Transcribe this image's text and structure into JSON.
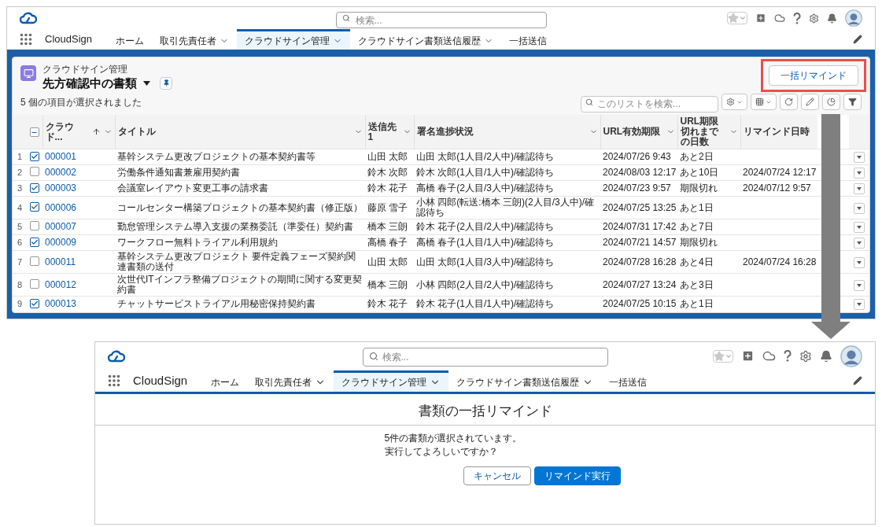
{
  "top_screen": {
    "header": {
      "search_placeholder": "検索..."
    },
    "nav": {
      "app_name": "CloudSign",
      "items": [
        {
          "label": "ホーム",
          "menu": false,
          "selected": false
        },
        {
          "label": "取引先責任者",
          "menu": true,
          "selected": false
        },
        {
          "label": "クラウドサイン管理",
          "menu": true,
          "selected": true
        },
        {
          "label": "クラウドサイン書類送信履歴",
          "menu": true,
          "selected": false
        },
        {
          "label": "一括送信",
          "menu": false,
          "selected": false
        }
      ]
    },
    "list_view": {
      "object_label": "クラウドサイン管理",
      "title": "先方確認中の書類",
      "reminder_button": "一括リマインド",
      "selection_note": "5 個の項目が選択されました",
      "search_placeholder": "このリストを検索...",
      "table": {
        "header_partial": true,
        "columns": [
          {
            "label": "クラウド...",
            "sorted": true,
            "menu": true
          },
          {
            "label": "タイトル",
            "sorted": false,
            "menu": true
          },
          {
            "label": "送信先1",
            "sorted": false,
            "menu": true
          },
          {
            "label": "署名進捗状況",
            "sorted": false,
            "menu": true
          },
          {
            "label": "URL有効期限",
            "sorted": false,
            "menu": true
          },
          {
            "label": "URL期限切れまでの日数",
            "sorted": false,
            "menu": true
          },
          {
            "label": "リマインド日時",
            "sorted": false,
            "menu": false
          }
        ],
        "rows": [
          {
            "number": "1",
            "checked": true,
            "id": "000001",
            "title": "基幹システム更改プロジェクトの基本契約書等",
            "recipient": "山田 太郎",
            "progress": "山田 太郎(1人目/2人中)/確認待ち",
            "url_expiry": "2024/07/26 9:43",
            "days_left": "あと2日"
          },
          {
            "number": "2",
            "checked": false,
            "id": "000002",
            "title": "労働条件通知書兼雇用契約書",
            "recipient": "鈴木 次郎",
            "progress": "鈴木 次郎(1人目/1人中)/確認待ち",
            "url_expiry": "2024/08/03 12:17",
            "days_left": "あと10日",
            "reminded_at": "2024/07/24 12:17"
          },
          {
            "number": "3",
            "checked": true,
            "id": "000003",
            "title": "会議室レイアウト変更工事の請求書",
            "recipient": "鈴木 花子",
            "progress": "高橋 春子(2人目/3人中)/確認待ち",
            "url_expiry": "2024/07/23 9:57",
            "days_left": "期限切れ",
            "reminded_at": "2024/07/12 9:57"
          },
          {
            "number": "4",
            "checked": true,
            "id": "000006",
            "title": "コールセンター構築プロジェクトの基本契約書（修正版）",
            "recipient": "藤原 雪子",
            "progress": "小林 四郎(転送:橋本 三朗)(2人目/3人中)/確認待ち",
            "url_expiry": "2024/07/25 13:25",
            "days_left": "あと1日"
          },
          {
            "number": "5",
            "checked": false,
            "id": "000007",
            "title": "勤怠管理システム導入支援の業務委託（準委任）契約書",
            "recipient": "橋本 三朗",
            "progress": "鈴木 花子(2人目/2人中)/確認待ち",
            "url_expiry": "2024/07/31 17:42",
            "days_left": "あと7日"
          },
          {
            "number": "6",
            "checked": true,
            "id": "000009",
            "title": "ワークフロー無料トライアル利用規約",
            "recipient": "高橋 春子",
            "progress": "高橋 春子(1人目/1人中)/確認待ち",
            "url_expiry": "2024/07/21 14:57",
            "days_left": "期限切れ"
          },
          {
            "number": "7",
            "checked": false,
            "id": "000011",
            "title": "基幹システム更改プロジェクト 要件定義フェーズ契約関連書類の送付",
            "recipient": "山田 太郎",
            "progress": "山田 太郎(1人目/3人中)/確認待ち",
            "url_expiry": "2024/07/28 16:28",
            "days_left": "あと4日",
            "reminded_at": "2024/07/24 16:28"
          },
          {
            "number": "8",
            "checked": false,
            "id": "000012",
            "title": "次世代ITインフラ整備プロジェクトの期間に関する変更契約書",
            "recipient": "橋本 三朗",
            "progress": "小林 四郎(2人目/2人中)/確認待ち",
            "url_expiry": "2024/07/27 13:24",
            "days_left": "あと3日"
          },
          {
            "number": "9",
            "checked": true,
            "id": "000013",
            "title": "チャットサービストライアル用秘密保持契約書",
            "recipient": "鈴木 花子",
            "progress": "鈴木 花子(1人目/1人中)/確認待ち",
            "url_expiry": "2024/07/25 10:15",
            "days_left": "あと1日"
          }
        ]
      }
    }
  },
  "bottom_screen": {
    "header": {
      "search_placeholder": "検索..."
    },
    "nav": {
      "app_name": "CloudSign",
      "items": [
        {
          "label": "ホーム",
          "menu": false,
          "selected": false
        },
        {
          "label": "取引先責任者",
          "menu": true,
          "selected": false
        },
        {
          "label": "クラウドサイン管理",
          "menu": true,
          "selected": true
        },
        {
          "label": "クラウドサイン書類送信履歴",
          "menu": true,
          "selected": false
        },
        {
          "label": "一括送信",
          "menu": false,
          "selected": false
        }
      ]
    },
    "dialog": {
      "title": "書類の一括リマインド",
      "message_lines": [
        "5件の書類が選択されています。",
        "実行してよろしいですか？"
      ],
      "buttons": [
        {
          "label": "キャンセル",
          "kind": "neutral"
        },
        {
          "label": "リマインド実行",
          "kind": "brand"
        }
      ]
    }
  }
}
